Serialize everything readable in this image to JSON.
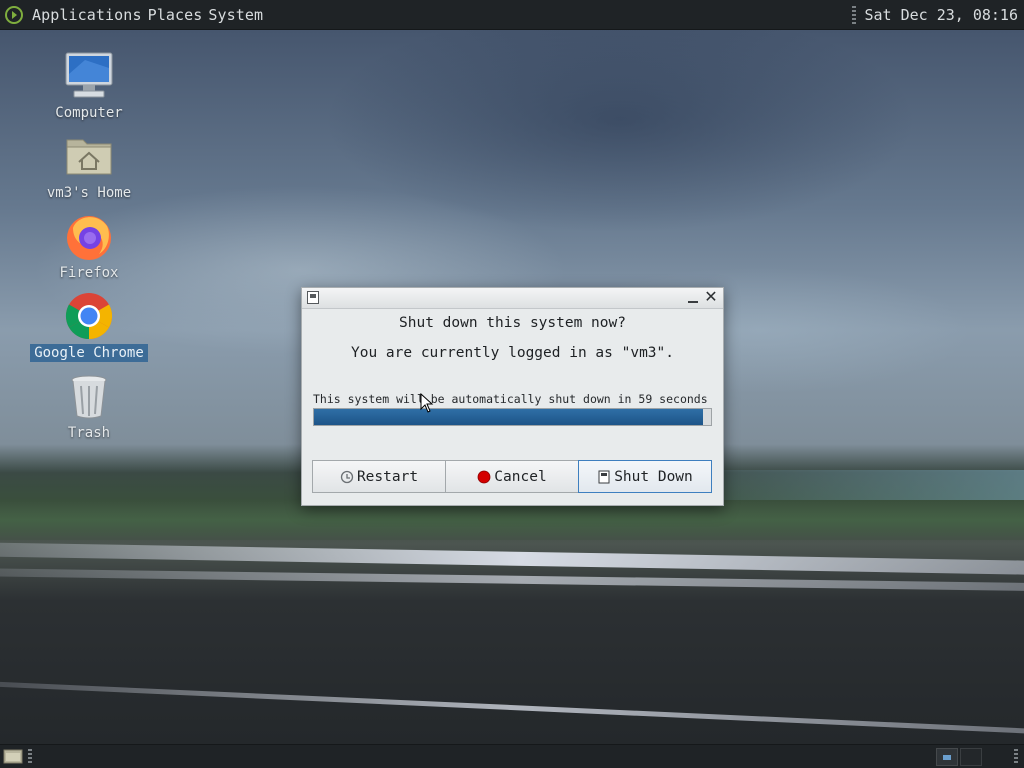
{
  "top_panel": {
    "menus": [
      "Applications",
      "Places",
      "System"
    ],
    "clock": "Sat Dec 23, 08:16"
  },
  "desktop": {
    "icons": [
      {
        "label": "Computer",
        "icon": "computer-icon"
      },
      {
        "label": "vm3's Home",
        "icon": "home-folder-icon"
      },
      {
        "label": "Firefox",
        "icon": "firefox-icon"
      },
      {
        "label": "Google Chrome",
        "icon": "chrome-icon",
        "selected": true
      },
      {
        "label": "Trash",
        "icon": "trash-icon"
      }
    ]
  },
  "dialog": {
    "heading": "Shut down this system now?",
    "subtext": "You are currently logged in as \"vm3\".",
    "countdown": "This system will be automatically shut down in 59 seconds",
    "progress_percent": 98,
    "buttons": {
      "restart": "Restart",
      "cancel": "Cancel",
      "shutdown": "Shut Down"
    }
  },
  "colors": {
    "panel_bg": "#1f2326",
    "progress_fill": "#1d5488",
    "selection": "#3d6c97"
  }
}
